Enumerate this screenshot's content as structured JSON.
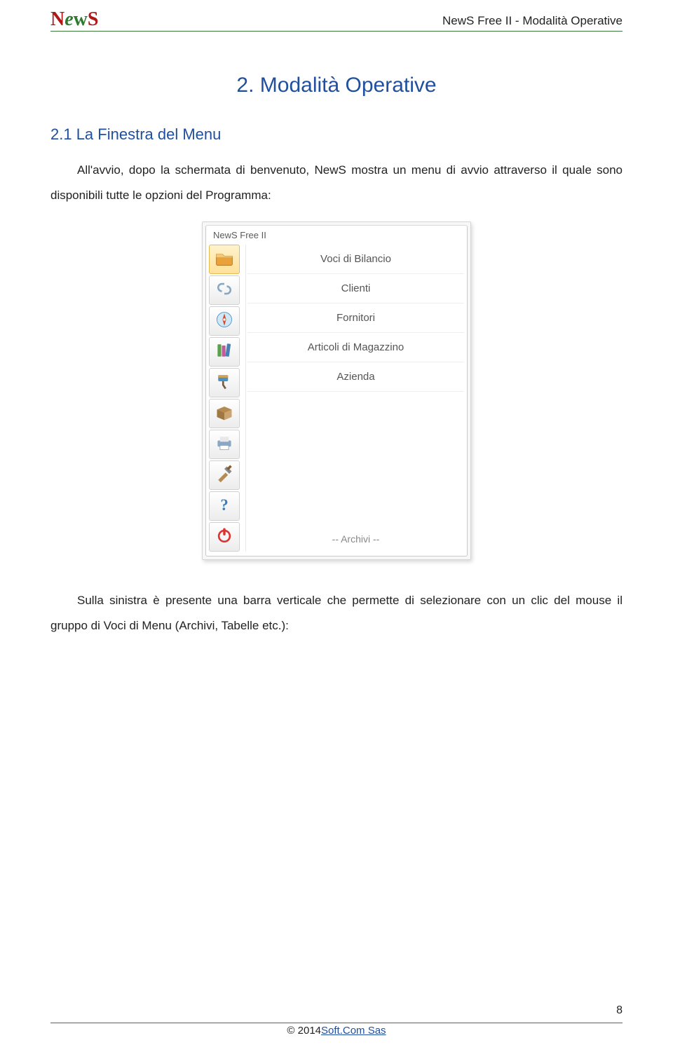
{
  "header": {
    "logo_text": "NewS",
    "doc_title": "NewS Free II -  Modalità Operative"
  },
  "chapter_title": "2. Modalità Operative",
  "section_title": "2.1 La Finestra del Menu",
  "para1": "All'avvio, dopo la schermata di benvenuto, NewS mostra un menu di avvio attraverso il quale sono disponibili tutte le opzioni del Programma:",
  "para2": "Sulla sinistra è presente una barra verticale che permette di selezionare con un clic del mouse il gruppo di Voci di Menu (Archivi, Tabelle etc.):",
  "screenshot": {
    "window_title": "NewS Free II",
    "sidebar_icons": [
      "folder-icon",
      "link-icon",
      "compass-icon",
      "books-icon",
      "brush-icon",
      "box-icon",
      "printer-icon",
      "tools-icon",
      "help-icon",
      "power-icon"
    ],
    "menu_items": [
      "Voci di Bilancio",
      "Clienti",
      "Fornitori",
      "Articoli di Magazzino",
      "Azienda"
    ],
    "footer_label": "-- Archivi --"
  },
  "footer": {
    "copyright": "© 2014 ",
    "link_text": "Soft.Com Sas"
  },
  "page_number": "8"
}
